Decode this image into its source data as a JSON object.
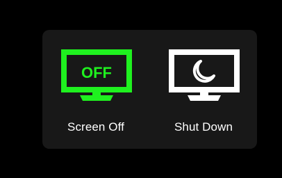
{
  "options": [
    {
      "id": "screen-off",
      "label": "Screen Off",
      "screen_text": "OFF",
      "icon": "monitor-off-icon",
      "color": "#1ff11f"
    },
    {
      "id": "shut-down",
      "label": "Shut Down",
      "icon": "monitor-sleep-moon-icon",
      "color": "#ffffff"
    }
  ],
  "colors": {
    "background": "#000000",
    "panel": "#181818",
    "accent": "#1ff11f",
    "text": "#ffffff"
  }
}
